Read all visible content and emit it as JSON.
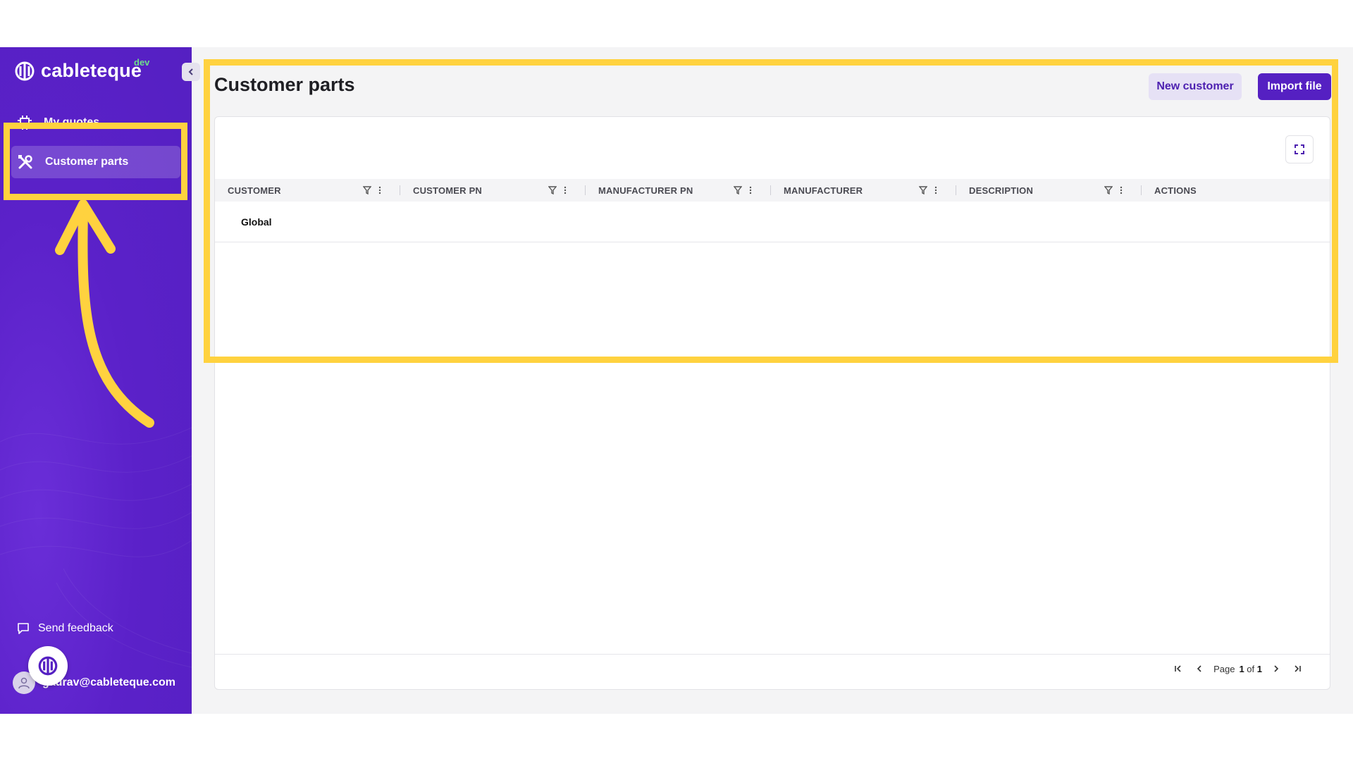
{
  "app": {
    "logo_text": "cableteque",
    "env_badge": "dev"
  },
  "sidebar": {
    "items": [
      {
        "label": "My quotes",
        "icon": "chip-icon"
      },
      {
        "label": "Customer parts",
        "icon": "tools-icon",
        "active": true
      }
    ],
    "feedback_label": "Send feedback",
    "user_email": "gaurav@cableteque.com"
  },
  "header": {
    "title": "Customer parts",
    "new_customer_label": "New customer",
    "import_label": "Import file"
  },
  "table": {
    "columns": [
      "CUSTOMER",
      "CUSTOMER PN",
      "MANUFACTURER PN",
      "MANUFACTURER",
      "DESCRIPTION",
      "ACTIONS"
    ],
    "rows": [
      {
        "customer": "Global"
      }
    ]
  },
  "pagination": {
    "page_label": "Page",
    "current": "1",
    "of_label": "of",
    "total": "1"
  },
  "colors": {
    "brand": "#5520c2",
    "highlight": "#ffd23f",
    "env_badge": "#6ee08a"
  }
}
